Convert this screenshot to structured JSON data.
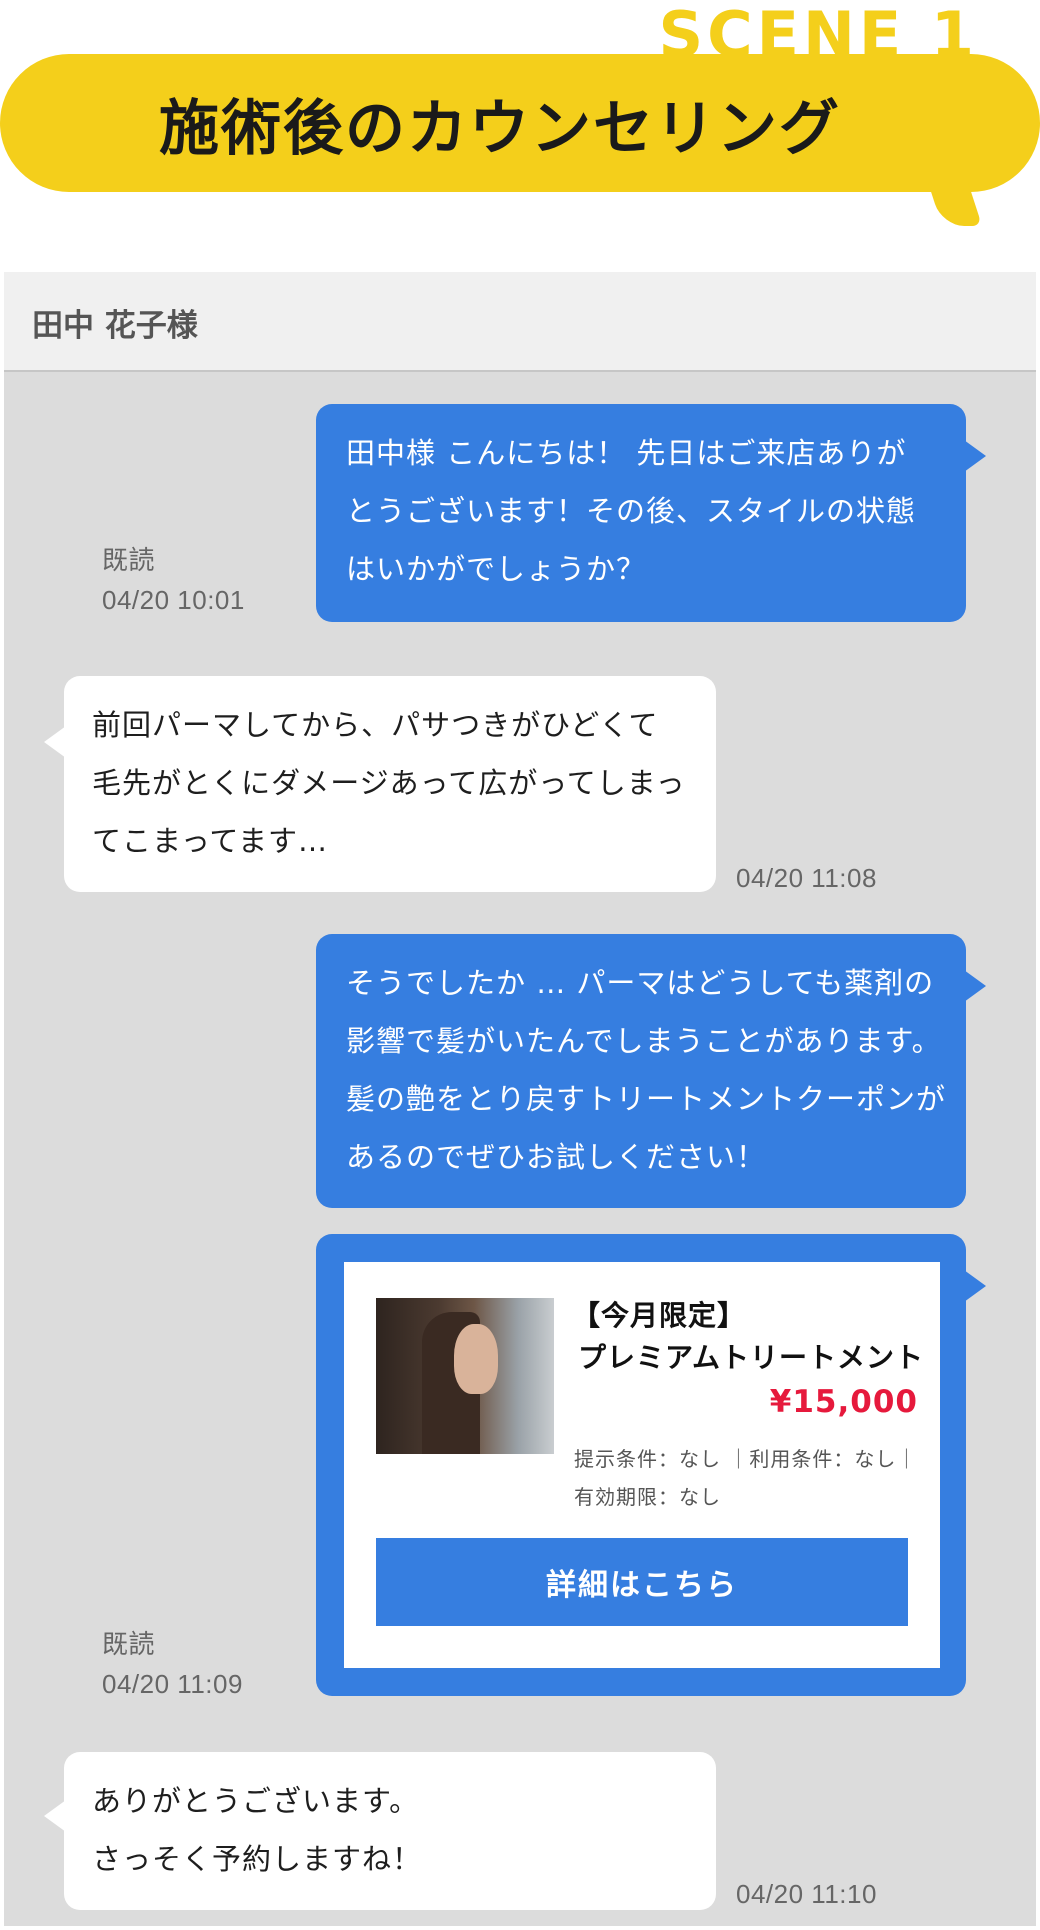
{
  "header": {
    "scene_label": "SCENE 1",
    "title": "施術後のカウンセリング"
  },
  "chat": {
    "customer_name": "田中 花子様",
    "messages": [
      {
        "side": "outgoing",
        "lines": [
          "田中様 こんにちは！ 先日はご来店ありが",
          "とうございます！その後、スタイルの状態",
          "はいかがでしょうか？"
        ],
        "read_status": "既読",
        "time": "04/20 10:01"
      },
      {
        "side": "incoming",
        "lines": [
          "前回パーマしてから、パサつきがひどくて",
          "毛先がとくにダメージあって広がってしまっ",
          "てこまってます…"
        ],
        "time": "04/20 11:08"
      },
      {
        "side": "outgoing",
        "lines": [
          "そうでしたか … パーマはどうしても薬剤の",
          "影響で髪がいたんでしまうことがあります。",
          "髪の艶をとり戻すトリートメントクーポンが",
          "あるのでぜひお試しください！"
        ]
      },
      {
        "side": "outgoing",
        "type": "coupon",
        "coupon": {
          "tag": "【今月限定】",
          "name": "プレミアムトリートメント",
          "price": "¥15,000",
          "conditions_line1": "提示条件：なし ｜利用条件：なし｜",
          "conditions_line2": "有効期限：なし",
          "button_label": "詳細はこちら",
          "image_icon": "woman-hair-photo"
        },
        "read_status": "既読",
        "time": "04/20 11:09"
      },
      {
        "side": "incoming",
        "lines": [
          "ありがとうございます。",
          "さっそく予約しますね！"
        ],
        "time": "04/20 11:10"
      }
    ]
  },
  "colors": {
    "accent_yellow": "#f4cf1b",
    "outgoing_bubble": "#367ee0",
    "incoming_bubble": "#ffffff",
    "chat_background": "#dcdcdc",
    "price_red": "#e6193c"
  }
}
